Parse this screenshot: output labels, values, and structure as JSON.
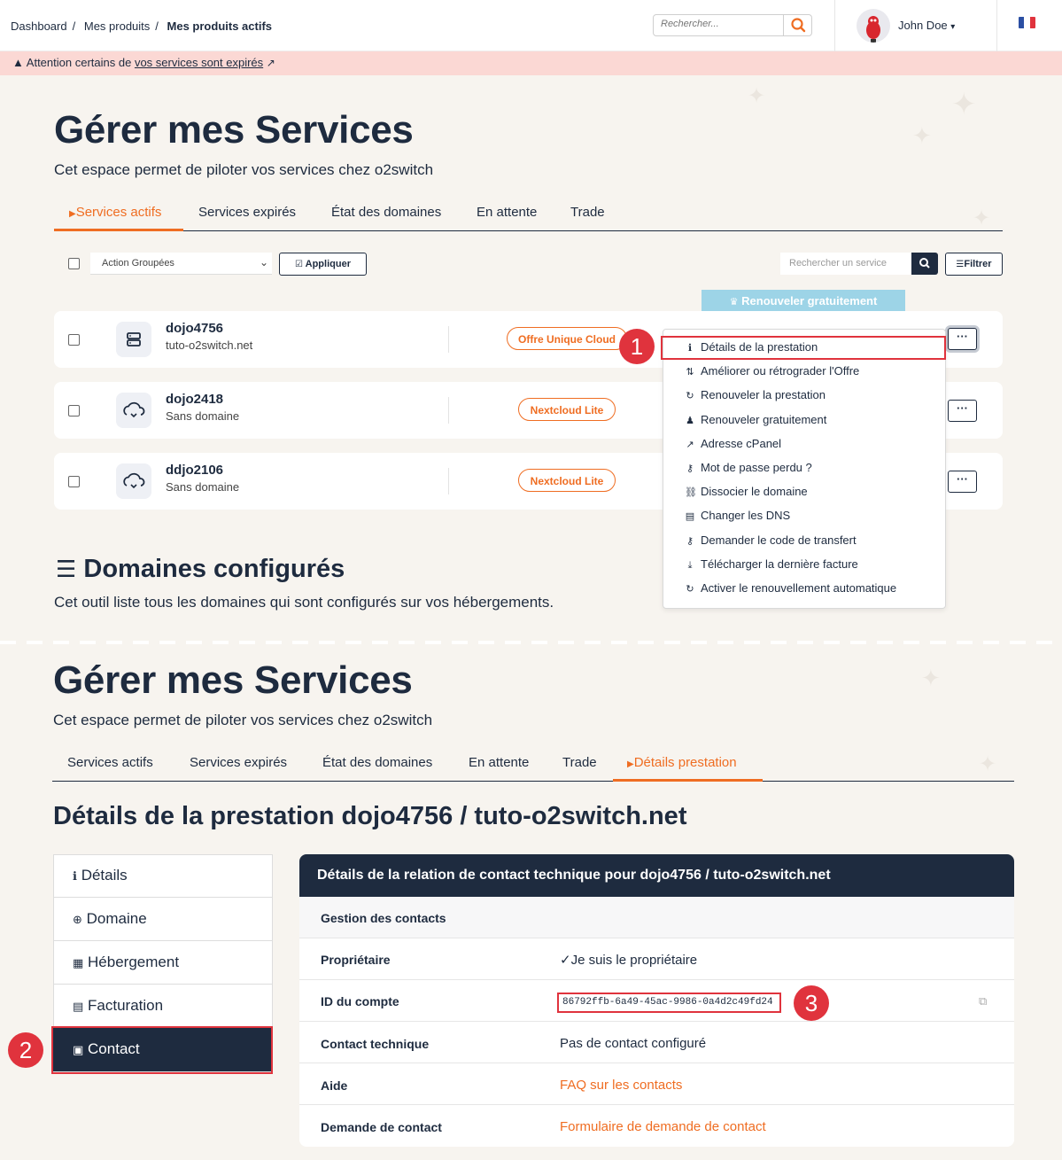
{
  "breadcrumb": [
    "Dashboard",
    "Mes produits",
    "Mes produits actifs"
  ],
  "header": {
    "search_placeholder": "Rechercher...",
    "user_name": "John Doe",
    "user_caret": "▾"
  },
  "alert": {
    "prefix": "Attention certains de",
    "link": "vos services sont expirés"
  },
  "top": {
    "title": "Gérer mes Services",
    "subtitle": "Cet espace permet de piloter vos services chez o2switch",
    "tabs": [
      "Services actifs",
      "Services expirés",
      "État des domaines",
      "En attente",
      "Trade"
    ],
    "active_tab": "Services actifs"
  },
  "toolbar": {
    "action_select": "Action Groupées",
    "apply": "Appliquer",
    "search_placeholder": "Rechercher un service",
    "filter": "Filtrer"
  },
  "renew_tip": "Renouveler gratuitement",
  "services": [
    {
      "name": "dojo4756",
      "domain": "tuto-o2switch.net",
      "offer": "Offre Unique Cloud",
      "icon": "server-icon"
    },
    {
      "name": "dojo2418",
      "domain": "Sans domaine",
      "offer": "Nextcloud Lite",
      "icon": "cloud-sync-icon"
    },
    {
      "name": "ddjo2106",
      "domain": "Sans domaine",
      "offer": "Nextcloud Lite",
      "icon": "cloud-sync-icon"
    }
  ],
  "dropdown": [
    {
      "label": "Détails de la prestation",
      "icon": "info-icon",
      "glyph": "ℹ"
    },
    {
      "label": "Améliorer ou rétrograder l'Offre",
      "icon": "exchange-icon",
      "glyph": "⇅"
    },
    {
      "label": "Renouveler la prestation",
      "icon": "refresh-icon",
      "glyph": "↻"
    },
    {
      "label": "Renouveler gratuitement",
      "icon": "gift-icon",
      "glyph": "♟"
    },
    {
      "label": "Adresse cPanel",
      "icon": "external-link-icon",
      "glyph": "↗"
    },
    {
      "label": "Mot de passe perdu ?",
      "icon": "key-icon",
      "glyph": "⚷"
    },
    {
      "label": "Dissocier le domaine",
      "icon": "unlink-icon",
      "glyph": "⛓"
    },
    {
      "label": "Changer les DNS",
      "icon": "dns-icon",
      "glyph": "▤"
    },
    {
      "label": "Demander le code de transfert",
      "icon": "key-icon",
      "glyph": "⚷"
    },
    {
      "label": "Télécharger la dernière facture",
      "icon": "download-icon",
      "glyph": "⤓"
    },
    {
      "label": "Activer le renouvellement automatique",
      "icon": "refresh-icon",
      "glyph": "↻"
    }
  ],
  "domains_section": {
    "title": "Domaines configurés",
    "subtitle": "Cet outil liste tous les domaines qui sont configurés sur vos hébergements."
  },
  "bottom": {
    "title": "Gérer mes Services",
    "subtitle": "Cet espace permet de piloter vos services chez o2switch",
    "tabs": [
      "Services actifs",
      "Services expirés",
      "État des domaines",
      "En attente",
      "Trade",
      "Détails prestation"
    ],
    "active_tab": "Détails prestation",
    "details_title": "Détails de la prestation dojo4756 / tuto-o2switch.net",
    "side_menu": [
      {
        "label": "Détails",
        "icon": "info-icon"
      },
      {
        "label": "Domaine",
        "icon": "globe-icon"
      },
      {
        "label": "Hébergement",
        "icon": "calendar-icon"
      },
      {
        "label": "Facturation",
        "icon": "invoice-icon"
      },
      {
        "label": "Contact",
        "icon": "contact-icon"
      }
    ],
    "active_menu": "Contact",
    "panel": {
      "title": "Détails de la relation de contact technique pour dojo4756 / tuto-o2switch.net",
      "section": "Gestion des contacts",
      "rows": [
        {
          "label": "Propriétaire",
          "value": "Je suis le propriétaire"
        },
        {
          "label": "ID du compte",
          "value": "86792ffb-6a49-45ac-9986-0a4d2c49fd24"
        },
        {
          "label": "Contact technique",
          "value": "Pas de contact configuré"
        },
        {
          "label": "Aide",
          "value": "FAQ sur les contacts"
        },
        {
          "label": "Demande de contact",
          "value": "Formulaire de demande de contact"
        }
      ]
    }
  },
  "steps": [
    "1",
    "2",
    "3"
  ],
  "colors": {
    "navy": "#1e2b3f",
    "orange": "#ef6d22",
    "red": "#e0333d",
    "alert_bg": "#fbd8d4",
    "tip_blue": "#9dd4e7"
  }
}
